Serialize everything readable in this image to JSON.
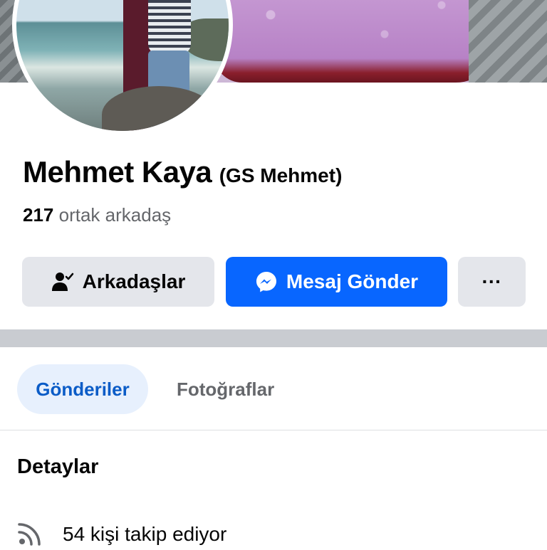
{
  "profile": {
    "name": "Mehmet Kaya",
    "alias": "(GS Mehmet)",
    "mutual_count": "217",
    "mutual_label": "ortak arkadaş"
  },
  "actions": {
    "friends_label": "Arkadaşlar",
    "message_label": "Mesaj Gönder",
    "more_label": "···"
  },
  "tabs": [
    {
      "label": "Gönderiler",
      "active": true
    },
    {
      "label": "Fotoğraflar",
      "active": false
    }
  ],
  "details": {
    "title": "Detaylar",
    "followers": "54 kişi takip ediyor"
  },
  "colors": {
    "primary": "#0866ff",
    "button_gray": "#e4e6eb",
    "active_tab_bg": "#e7f0fd",
    "active_tab_text": "#0b5cc7",
    "secondary_text": "#65676b"
  },
  "icons": [
    "friends-check-icon",
    "messenger-icon",
    "more-icon",
    "rss-icon"
  ]
}
